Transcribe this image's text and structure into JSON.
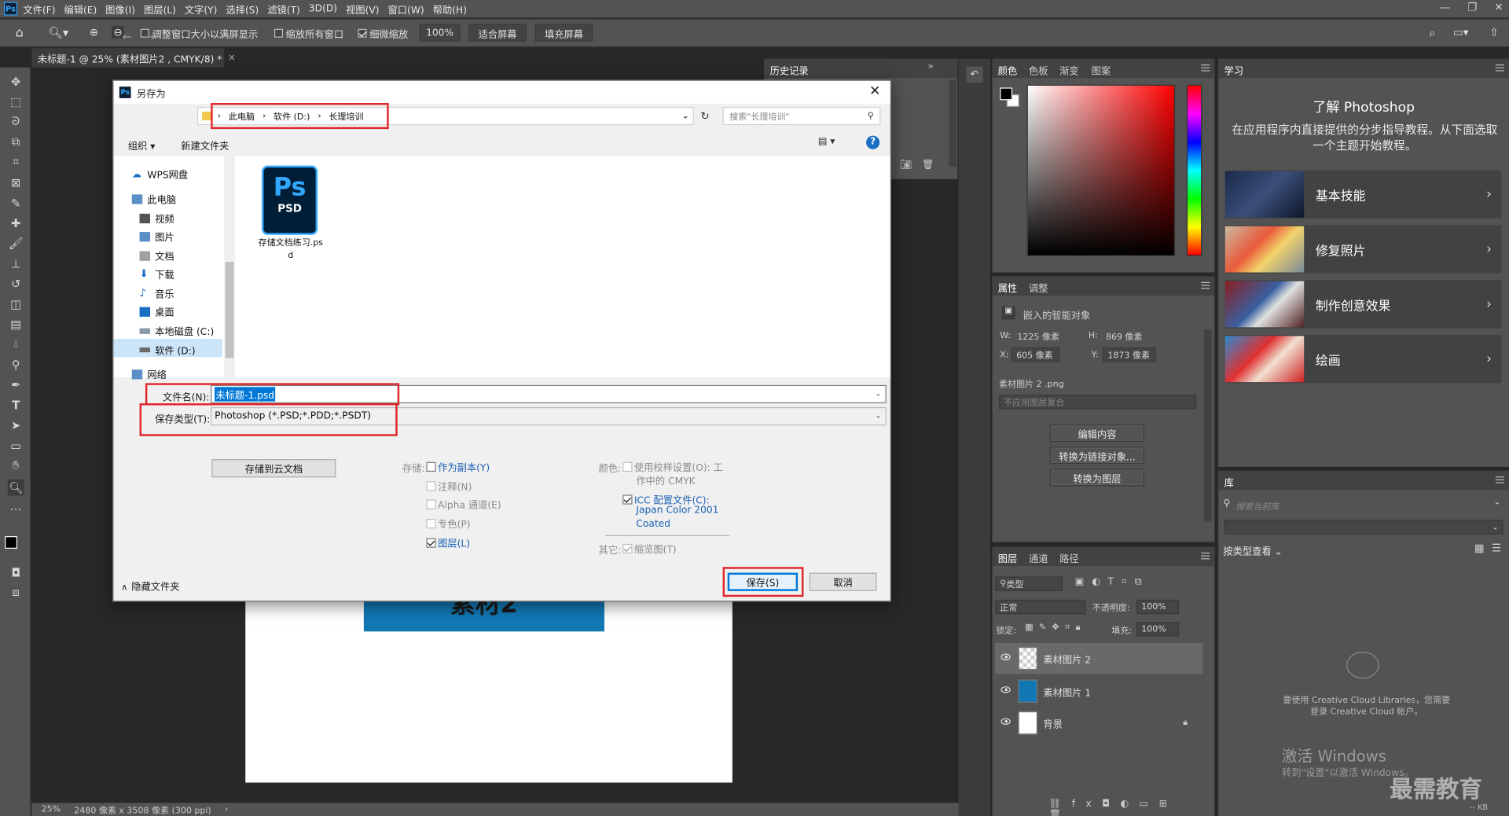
{
  "app": {
    "logo": "Ps"
  },
  "menu": [
    "文件(F)",
    "编辑(E)",
    "图像(I)",
    "图层(L)",
    "文字(Y)",
    "选择(S)",
    "滤镜(T)",
    "3D(D)",
    "视图(V)",
    "窗口(W)",
    "帮助(H)"
  ],
  "options_bar": {
    "resize_windows": "调整窗口大小以满屏显示",
    "zoom_all": "缩放所有窗口",
    "scrubby_zoom": "细微缩放",
    "zoom_value": "100%",
    "fit_screen": "适合屏幕",
    "fill_screen": "填充屏幕"
  },
  "document": {
    "tab_title": "未标题-1 @ 25% (素材图片2 , CMYK/8) *",
    "canvas_text": "素材2",
    "status_zoom": "25%",
    "status_info": "2480 像素 x 3508 像素 (300 ppi)"
  },
  "history_panel": {
    "tab": "历史记录"
  },
  "color_panel": {
    "tabs": [
      "颜色",
      "色板",
      "渐变",
      "图案"
    ]
  },
  "properties_panel": {
    "tabs": [
      "属性",
      "调整"
    ],
    "object_type": "嵌入的智能对象",
    "w_label": "W:",
    "w_value": "1225 像素",
    "h_label": "H:",
    "h_value": "869 像素",
    "x_label": "X:",
    "x_value": "605 像素",
    "y_label": "Y:",
    "y_value": "1873 像素",
    "file_name": "素材图片 2 .png",
    "comp_placeholder": "不应用图层复合",
    "buttons": [
      "编辑内容",
      "转换为链接对象...",
      "转换为图层"
    ]
  },
  "layers_panel": {
    "tabs": [
      "图层",
      "通道",
      "路径"
    ],
    "filter": "类型",
    "blend_mode": "正常",
    "opacity_label": "不透明度:",
    "opacity_value": "100%",
    "lock_label": "锁定:",
    "fill_label": "填充:",
    "fill_value": "100%",
    "layers": [
      {
        "name": "素材图片 2"
      },
      {
        "name": "素材图片 1"
      },
      {
        "name": "背景"
      }
    ]
  },
  "learn_panel": {
    "tab": "学习",
    "title": "了解 Photoshop",
    "description": "在应用程序内直接提供的分步指导教程。从下面选取一个主题开始教程。",
    "topics": [
      "基本技能",
      "修复照片",
      "制作创意效果",
      "绘画"
    ]
  },
  "library_panel": {
    "tab": "库",
    "search_placeholder": "搜索当前库",
    "view_by": "按类型查看",
    "cc_message": "要使用 Creative Cloud Libraries，您需要登录 Creative Cloud 帐户。",
    "kb": "-- KB"
  },
  "watermarks": {
    "activate": "激活 Windows",
    "activate_sub": "转到\"设置\"以激活 Windows。",
    "brand": "最需教育"
  },
  "save_dialog": {
    "title": "另存为",
    "breadcrumb": [
      "此电脑",
      "软件 (D:)",
      "长理培训"
    ],
    "search_placeholder": "搜索\"长理培训\"",
    "organize": "组织 ▾",
    "new_folder": "新建文件夹",
    "sidebar": [
      "WPS网盘",
      "此电脑",
      "视频",
      "图片",
      "文档",
      "下载",
      "音乐",
      "桌面",
      "本地磁盘 (C:)",
      "软件 (D:)",
      "网络"
    ],
    "file_icon_label": "PSD",
    "file_icon_logo": "Ps",
    "file_name_display": "存储文档练习.psd",
    "filename_label": "文件名(N):",
    "filename_value": "未标题-1.psd",
    "filetype_label": "保存类型(T):",
    "filetype_value": "Photoshop (*.PSD;*.PDD;*.PSDT)",
    "cloud_button": "存储到云文档",
    "save_label": "存储:",
    "save_options": [
      {
        "label": "作为副本(Y)",
        "checked": false,
        "enabled": true
      },
      {
        "label": "注释(N)",
        "checked": false,
        "enabled": false
      },
      {
        "label": "Alpha 通道(E)",
        "checked": false,
        "enabled": false
      },
      {
        "label": "专色(P)",
        "checked": false,
        "enabled": false
      },
      {
        "label": "图层(L)",
        "checked": true,
        "enabled": true
      }
    ],
    "color_label": "颜色:",
    "proof_setup": "使用校样设置(O):  工",
    "proof_setup_2": "作中的 CMYK",
    "icc_label": "ICC 配置文件(C):",
    "icc_value_1": "Japan Color 2001",
    "icc_value_2": "Coated",
    "other_label": "其它:",
    "thumbnail": "缩览图(T)",
    "hide_folders": "隐藏文件夹",
    "save_button": "保存(S)",
    "cancel_button": "取消"
  }
}
